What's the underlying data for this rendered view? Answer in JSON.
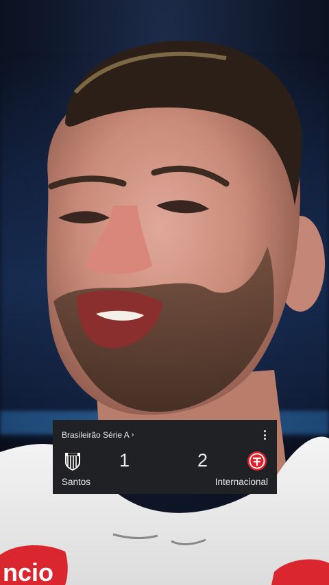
{
  "scoreboard": {
    "competition": "Brasileirão Série A",
    "chevron": "›",
    "home": {
      "name": "Santos",
      "score": "1",
      "logo_icon": "santos-crest-icon"
    },
    "away": {
      "name": "Internacional",
      "score": "2",
      "logo_icon": "internacional-crest-icon"
    },
    "accent_away": "#e2202b"
  },
  "jersey": {
    "sponsor_partial": "ncio"
  }
}
